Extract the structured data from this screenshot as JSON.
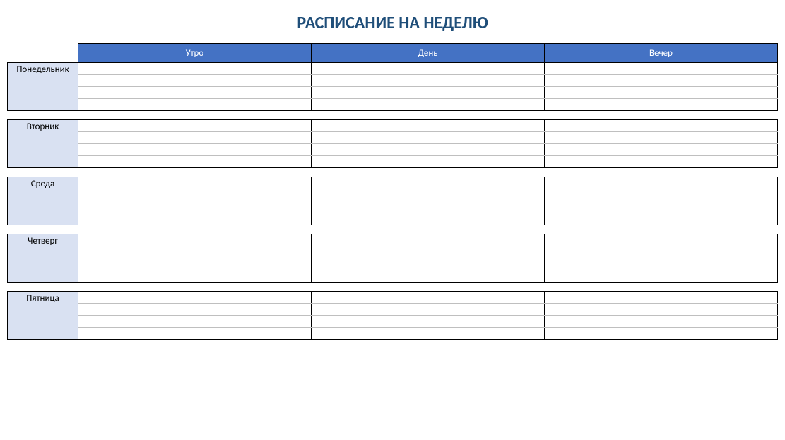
{
  "title": "РАСПИСАНИЕ НА НЕДЕЛЮ",
  "headers": {
    "morning": "Утро",
    "day": "День",
    "evening": "Вечер"
  },
  "days": [
    {
      "name": "Понедельник",
      "rows": [
        [
          "",
          "",
          ""
        ],
        [
          "",
          "",
          ""
        ],
        [
          "",
          "",
          ""
        ],
        [
          "",
          "",
          ""
        ]
      ]
    },
    {
      "name": "Вторник",
      "rows": [
        [
          "",
          "",
          ""
        ],
        [
          "",
          "",
          ""
        ],
        [
          "",
          "",
          ""
        ],
        [
          "",
          "",
          ""
        ]
      ]
    },
    {
      "name": "Среда",
      "rows": [
        [
          "",
          "",
          ""
        ],
        [
          "",
          "",
          ""
        ],
        [
          "",
          "",
          ""
        ],
        [
          "",
          "",
          ""
        ]
      ]
    },
    {
      "name": "Четверг",
      "rows": [
        [
          "",
          "",
          ""
        ],
        [
          "",
          "",
          ""
        ],
        [
          "",
          "",
          ""
        ],
        [
          "",
          "",
          ""
        ]
      ]
    },
    {
      "name": "Пятница",
      "rows": [
        [
          "",
          "",
          ""
        ],
        [
          "",
          "",
          ""
        ],
        [
          "",
          "",
          ""
        ],
        [
          "",
          "",
          ""
        ]
      ]
    }
  ]
}
